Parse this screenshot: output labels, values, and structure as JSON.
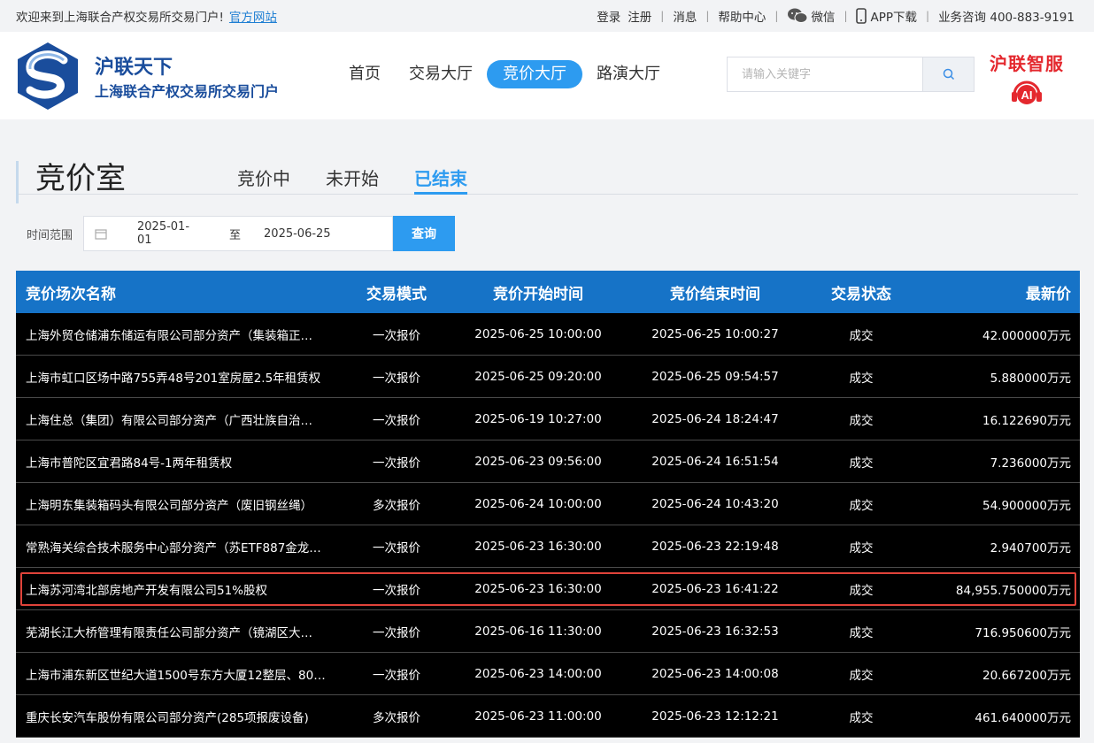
{
  "topbar": {
    "welcome": "欢迎来到上海联合产权交易所交易门户!",
    "official_link": "官方网站",
    "login": "登录",
    "register": "注册",
    "messages": "消息",
    "help": "帮助中心",
    "wechat": "微信",
    "app": "APP下载",
    "hotline": "业务咨询 400-883-9191"
  },
  "header": {
    "brand_title": "沪联天下",
    "brand_subtitle": "上海联合产权交易所交易门户",
    "nav": [
      "首页",
      "交易大厅",
      "竞价大厅",
      "路演大厅"
    ],
    "nav_active": "竞价大厅",
    "search_placeholder": "请输入关键字",
    "ai_title": "沪联智服",
    "ai_badge": "AI"
  },
  "page": {
    "title": "竞价室",
    "tabs": [
      "竞价中",
      "未开始",
      "已结束"
    ],
    "active_tab": "已结束",
    "filter_label": "时间范围",
    "date_from": "2025-01-01",
    "date_to_sep": "至",
    "date_to": "2025-06-25",
    "query_button": "查询"
  },
  "table": {
    "headers": [
      "竞价场次名称",
      "交易模式",
      "竞价开始时间",
      "竞价结束时间",
      "交易状态",
      "最新价"
    ],
    "rows": [
      [
        "上海外贸仓储浦东储运有限公司部分资产（集装箱正…",
        "一次报价",
        "2025-06-25 10:00:00",
        "2025-06-25 10:00:27",
        "成交",
        "42.000000万元"
      ],
      [
        "上海市虹口区场中路755弄48号201室房屋2.5年租赁权",
        "一次报价",
        "2025-06-25 09:20:00",
        "2025-06-25 09:54:57",
        "成交",
        "5.880000万元"
      ],
      [
        "上海住总（集团）有限公司部分资产（广西壮族自治…",
        "一次报价",
        "2025-06-19 10:27:00",
        "2025-06-24 18:24:47",
        "成交",
        "16.122690万元"
      ],
      [
        "上海市普陀区宜君路84号-1两年租赁权",
        "一次报价",
        "2025-06-23 09:56:00",
        "2025-06-24 16:51:54",
        "成交",
        "7.236000万元"
      ],
      [
        "上海明东集装箱码头有限公司部分资产（废旧钢丝绳）",
        "多次报价",
        "2025-06-24 10:00:00",
        "2025-06-24 10:43:20",
        "成交",
        "54.900000万元"
      ],
      [
        "常熟海关综合技术服务中心部分资产（苏ETF887金龙…",
        "一次报价",
        "2025-06-23 16:30:00",
        "2025-06-23 22:19:48",
        "成交",
        "2.940700万元"
      ],
      [
        "上海苏河湾北部房地产开发有限公司51%股权",
        "一次报价",
        "2025-06-23 16:30:00",
        "2025-06-23 16:41:22",
        "成交",
        "84,955.750000万元"
      ],
      [
        "芜湖长江大桥管理有限责任公司部分资产（镜湖区大…",
        "一次报价",
        "2025-06-16 11:30:00",
        "2025-06-23 16:32:53",
        "成交",
        "716.950600万元"
      ],
      [
        "上海市浦东新区世纪大道1500号东方大厦12整层、80…",
        "一次报价",
        "2025-06-23 14:00:00",
        "2025-06-23 14:00:08",
        "成交",
        "20.667200万元"
      ],
      [
        "重庆长安汽车股份有限公司部分资产(285项报废设备)",
        "多次报价",
        "2025-06-23 11:00:00",
        "2025-06-23 12:12:21",
        "成交",
        "461.640000万元"
      ]
    ],
    "highlighted_row": 6
  }
}
